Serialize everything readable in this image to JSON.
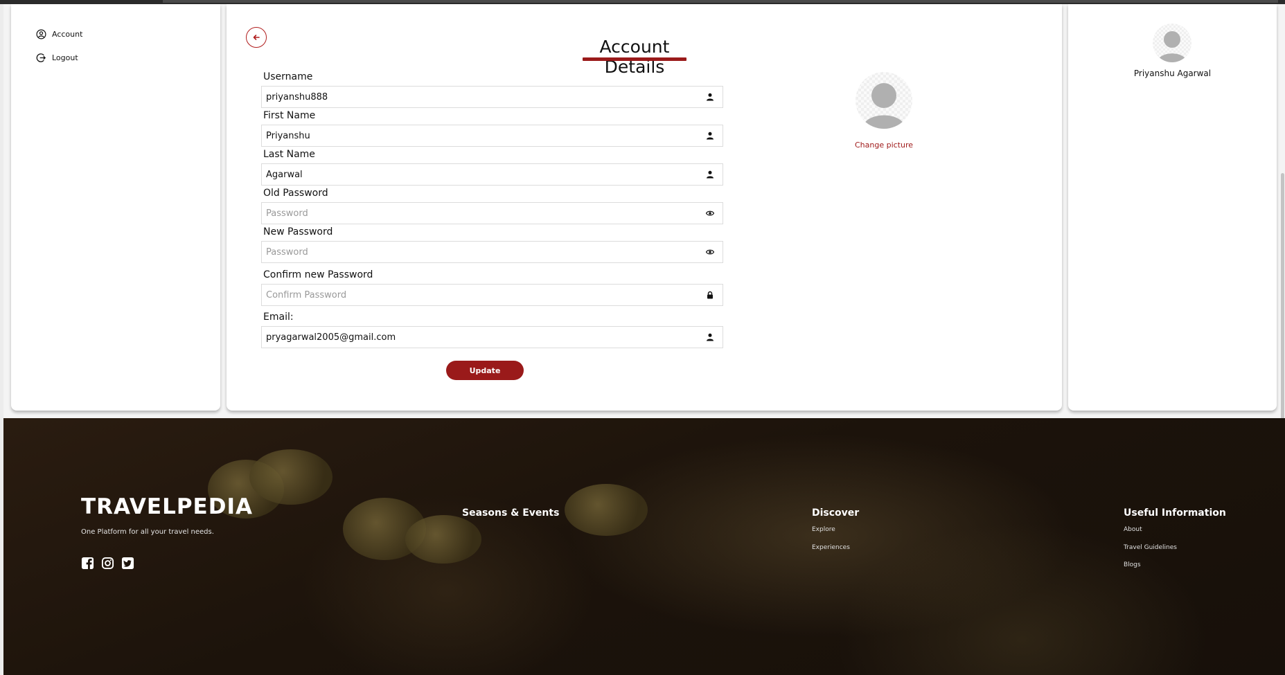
{
  "sidebar": {
    "items": [
      {
        "label": "Account",
        "icon": "user-circle-icon"
      },
      {
        "label": "Logout",
        "icon": "logout-icon"
      }
    ]
  },
  "main": {
    "title": "Account Details",
    "form": {
      "username": {
        "label": "Username",
        "value": "priyanshu888",
        "icon": "user-icon"
      },
      "first_name": {
        "label": "First Name",
        "value": "Priyanshu",
        "icon": "user-icon"
      },
      "last_name": {
        "label": "Last Name",
        "value": "Agarwal",
        "icon": "user-icon"
      },
      "old_password": {
        "label": "Old Password",
        "placeholder": "Password",
        "icon": "eye-icon"
      },
      "new_password": {
        "label": "New Password",
        "placeholder": "Password",
        "icon": "eye-icon"
      },
      "confirm_password": {
        "label": "Confirm new Password",
        "placeholder": "Confirm Password",
        "icon": "lock-icon"
      },
      "email": {
        "label": "Email:",
        "value": "pryagarwal2005@gmail.com",
        "icon": "user-icon"
      }
    },
    "update_label": "Update",
    "change_picture_label": "Change picture"
  },
  "profile": {
    "name": "Priyanshu Agarwal"
  },
  "footer": {
    "brand": "TRAVELPEDIA",
    "tagline": "One Platform for all your travel needs.",
    "social_icons": [
      "facebook-icon",
      "instagram-icon",
      "twitter-icon"
    ],
    "columns": [
      {
        "heading": "Seasons & Events",
        "links": []
      },
      {
        "heading": "Discover",
        "links": [
          "Explore",
          "Experiences"
        ]
      },
      {
        "heading": "Useful Information",
        "links": [
          "About",
          "Travel Guidelines",
          "Blogs"
        ]
      }
    ]
  },
  "colors": {
    "accent": "#9a1a1a",
    "footer_bg": "#1c130b"
  }
}
